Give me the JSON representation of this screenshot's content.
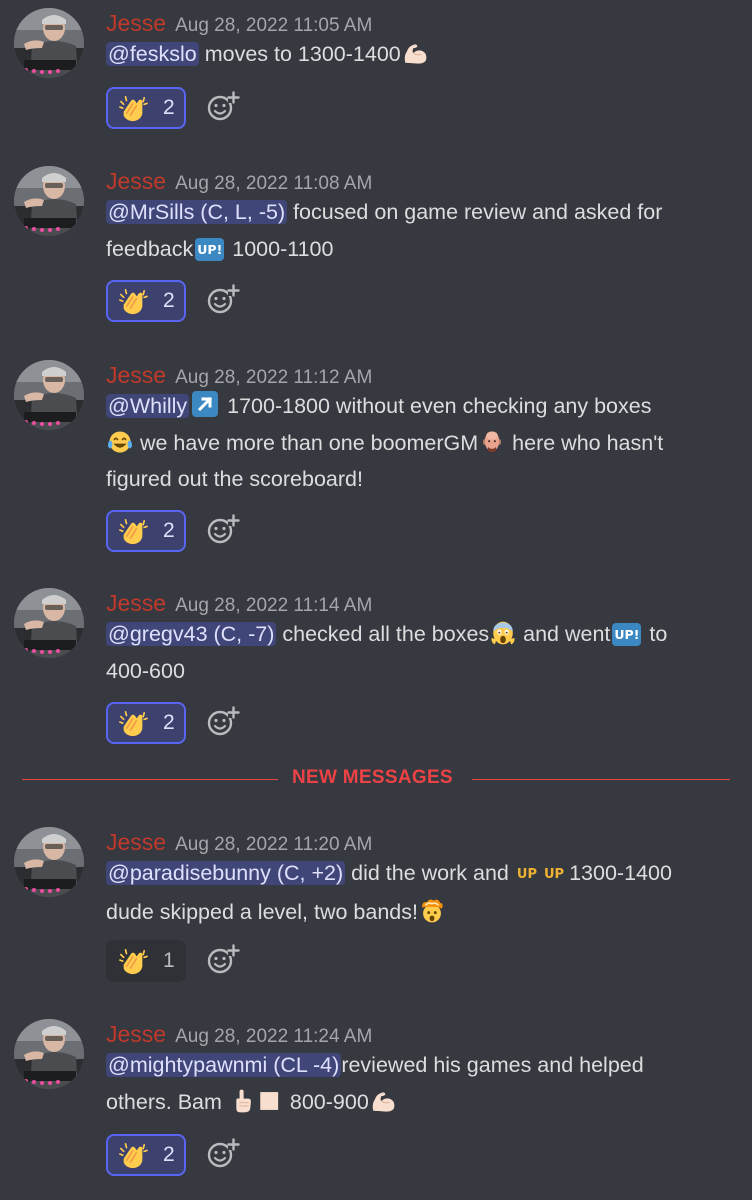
{
  "colors": {
    "background": "#36393f",
    "username": "#c0392b",
    "timestamp": "#a3a6aa",
    "mention_bg": "#4e548c",
    "reaction_active_border": "#5865f2",
    "new_messages": "#ed4245"
  },
  "divider": {
    "label": "NEW MESSAGES"
  },
  "messages": [
    {
      "author": "Jesse",
      "timestamp": "Aug 28, 2022 11:05 AM",
      "mention": "@feskslo",
      "text_1": " moves to 1300-1400",
      "emoji_1": "flexed-biceps",
      "reaction": {
        "emoji": "clapping-hands",
        "count": "2",
        "active": true
      }
    },
    {
      "author": "Jesse",
      "timestamp": "Aug 28, 2022 11:08 AM",
      "mention": "@MrSills (C, L, -5)",
      "text_1": " focused on game review and asked for",
      "text_2": "feedback",
      "badge_1": "UP!",
      "text_3": " 1000-1100",
      "reaction": {
        "emoji": "clapping-hands",
        "count": "2",
        "active": true
      }
    },
    {
      "author": "Jesse",
      "timestamp": "Aug 28, 2022 11:12 AM",
      "mention": "@Whilly",
      "emoji_1": "up-right-arrow",
      "text_1": " 1700-1800 without even checking any boxes",
      "emoji_2": "face-with-tears-of-joy",
      "text_2": " we have more than one boomerGM",
      "emoji_3": "bald-man-face",
      "text_3": " here who hasn't",
      "text_4": "figured out the scoreboard!",
      "reaction": {
        "emoji": "clapping-hands",
        "count": "2",
        "active": true
      }
    },
    {
      "author": "Jesse",
      "timestamp": "Aug 28, 2022 11:14 AM",
      "mention": "@gregv43 (C, -7)",
      "text_1": " checked all the boxes",
      "emoji_1": "face-screaming-in-fear",
      "text_2": " and went",
      "badge_1": "UP!",
      "text_3": " to",
      "text_4": "400-600",
      "reaction": {
        "emoji": "clapping-hands",
        "count": "2",
        "active": true
      }
    },
    {
      "author": "Jesse",
      "timestamp": "Aug 28, 2022 11:20 AM",
      "mention": "@paradisebunny (C, +2)",
      "text_1": " did the work and",
      "badge_1": "UP",
      "badge_2": "UP",
      "text_2": "1300-1400",
      "text_3": "dude skipped a level, two bands!",
      "emoji_1": "exploding-head",
      "reaction": {
        "emoji": "clapping-hands",
        "count": "1",
        "active": false
      }
    },
    {
      "author": "Jesse",
      "timestamp": "Aug 28, 2022 11:24 AM",
      "mention": "@mightypawnmi (CL -4)",
      "text_1": "reviewed his games and helped",
      "text_2": "others. Bam",
      "emoji_1": "index-pointing-up",
      "text_3": " 800-900",
      "emoji_2": "flexed-biceps",
      "reaction": {
        "emoji": "clapping-hands",
        "count": "2",
        "active": true
      }
    }
  ]
}
